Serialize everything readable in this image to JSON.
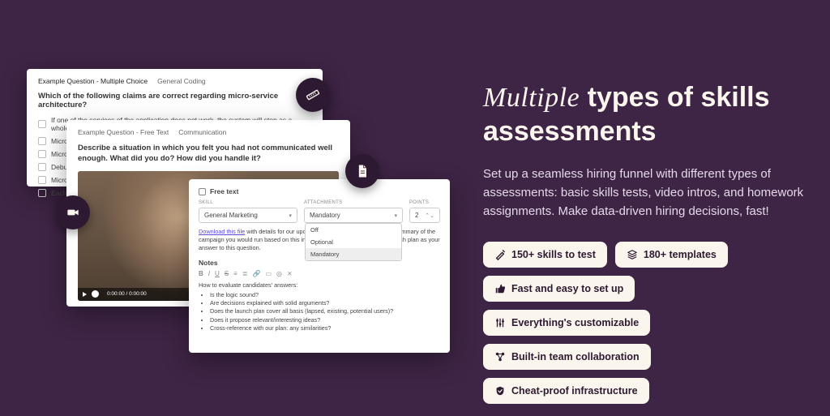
{
  "headline_em": "Multiple",
  "headline_rest": " types of skills assessments",
  "body": "Set up a seamless hiring funnel with different types of assessments: basic skills tests, video intros, and homework assignments. Make data-driven hiring decisions, fast!",
  "pills": {
    "skills": "150+ skills to test",
    "templates": "180+ templates",
    "fast": "Fast and easy to set up",
    "custom": "Everything's customizable",
    "collab": "Built-in team collaboration",
    "cheat": "Cheat-proof infrastructure"
  },
  "card1": {
    "tab1": "Example Question - Multiple Choice",
    "tab2": "General Coding",
    "question": "Which of the following claims are correct regarding micro-service architecture?",
    "opts": [
      "If one of the services of the application does not work, the system will stop as a whole",
      "Micro-Servic",
      "Micro-Servic",
      "Debugging a",
      "Micro-Servic upgraded",
      "Each service"
    ]
  },
  "card2": {
    "tab1": "Example Question - Free Text",
    "tab2": "Communication",
    "question": "Describe a situation in which you felt you had not communicated well enough. What did you do? How did you handle it?",
    "time": "0:00:00 / 0:00:00"
  },
  "card3": {
    "title": "Free text",
    "labels": {
      "skill": "SKILL",
      "attach": "ATTACHMENTS",
      "points": "POINTS"
    },
    "skill": "General Marketing",
    "attach_sel": "Mandatory",
    "points": "2",
    "opts": {
      "off": "Off",
      "optional": "Optional",
      "mandatory": "Mandatory"
    },
    "desc_link": "Download this file",
    "desc_rest": " with details for our upcoming product launch and write a summary of the campaign you would run based on this information. Upload your product launch plan as your answer to this question.",
    "notes": "Notes",
    "eval": "How to evaluate candidates' answers:",
    "items": [
      "Is the logic sound?",
      "Are decisions explained with solid arguments?",
      "Does the launch plan cover all basis (lapsed, existing, potential users)?",
      "Does it propose relevant/interesting ideas?",
      "Cross-reference with our plan: any similarities?"
    ]
  }
}
